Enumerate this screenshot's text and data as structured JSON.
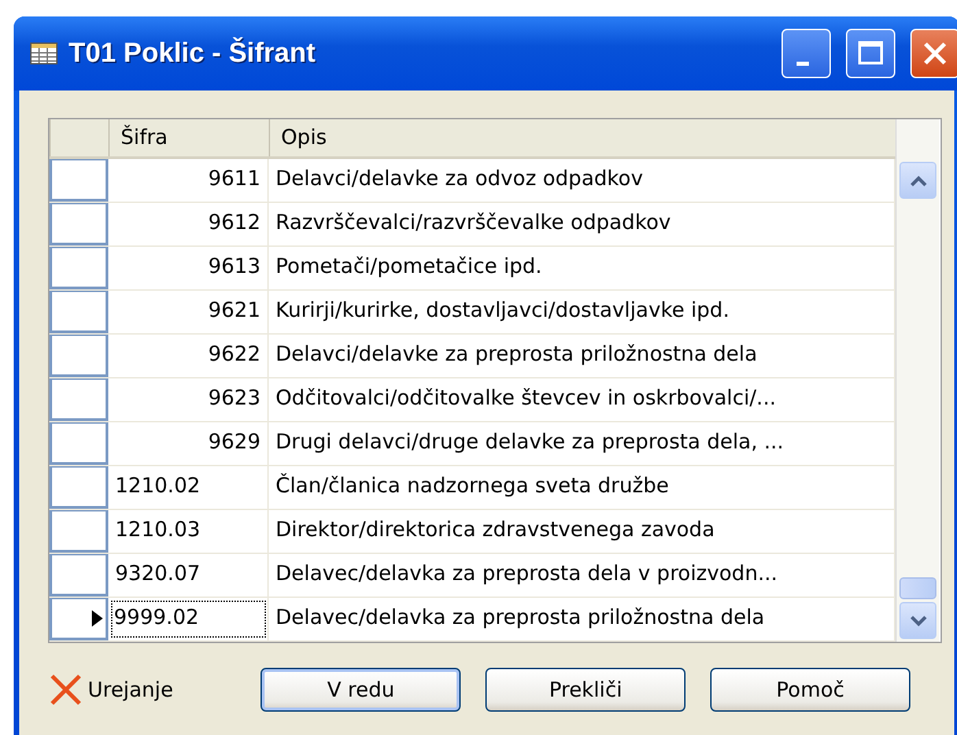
{
  "window": {
    "title": "T01 Poklic - Šifrant"
  },
  "table": {
    "columns": [
      "Šifra",
      "Opis"
    ],
    "rows": [
      {
        "code": "9611",
        "kind": "number",
        "description": "Delavci/delavke za odvoz odpadkov",
        "selected": false
      },
      {
        "code": "9612",
        "kind": "number",
        "description": "Razvrščevalci/razvrščevalke odpadkov",
        "selected": false
      },
      {
        "code": "9613",
        "kind": "number",
        "description": "Pometači/pometačice ipd.",
        "selected": false
      },
      {
        "code": "9621",
        "kind": "number",
        "description": "Kurirji/kurirke, dostavljavci/dostavljavke ipd.",
        "selected": false
      },
      {
        "code": "9622",
        "kind": "number",
        "description": "Delavci/delavke za preprosta priložnostna dela",
        "selected": false
      },
      {
        "code": "9623",
        "kind": "number",
        "description": "Odčitovalci/odčitovalke števcev in oskrbovalci/...",
        "selected": false
      },
      {
        "code": "9629",
        "kind": "number",
        "description": "Drugi delavci/druge delavke za preprosta dela, ...",
        "selected": false
      },
      {
        "code": "1210.02",
        "kind": "text",
        "description": "Član/članica nadzornega sveta družbe",
        "selected": false
      },
      {
        "code": "1210.03",
        "kind": "text",
        "description": "Direktor/direktorica zdravstvenega zavoda",
        "selected": false
      },
      {
        "code": "9320.07",
        "kind": "text",
        "description": "Delavec/delavka za preprosta dela v proizvodn...",
        "selected": false
      },
      {
        "code": "9999.02",
        "kind": "text",
        "description": "Delavec/delavka za preprosta priložnostna dela",
        "selected": true
      }
    ]
  },
  "edit_mode": {
    "label": "Urejanje"
  },
  "buttons": [
    "V redu",
    "Prekliči",
    "Pomoč"
  ]
}
